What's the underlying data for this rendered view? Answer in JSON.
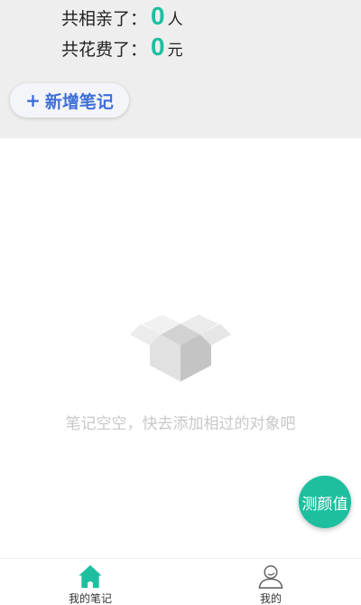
{
  "stats": {
    "dates": {
      "label": "共相亲了：",
      "value": "0",
      "unit": "人"
    },
    "cost": {
      "label": "共花费了：",
      "value": "0",
      "unit": "元"
    }
  },
  "add_note": {
    "plus": "+",
    "label": "新增笔记"
  },
  "empty_state": {
    "icon": "empty-box-icon",
    "text": "笔记空空，快去添加相过的对象吧"
  },
  "fab": {
    "label": "测颜值"
  },
  "tabbar": {
    "tabs": [
      {
        "label": "我的笔记",
        "icon": "home-icon",
        "active": true
      },
      {
        "label": "我的",
        "icon": "user-icon",
        "active": false
      }
    ]
  },
  "colors": {
    "accent": "#1dbf9f",
    "button_text": "#3f6fd8",
    "panel": "#eeeeee"
  }
}
